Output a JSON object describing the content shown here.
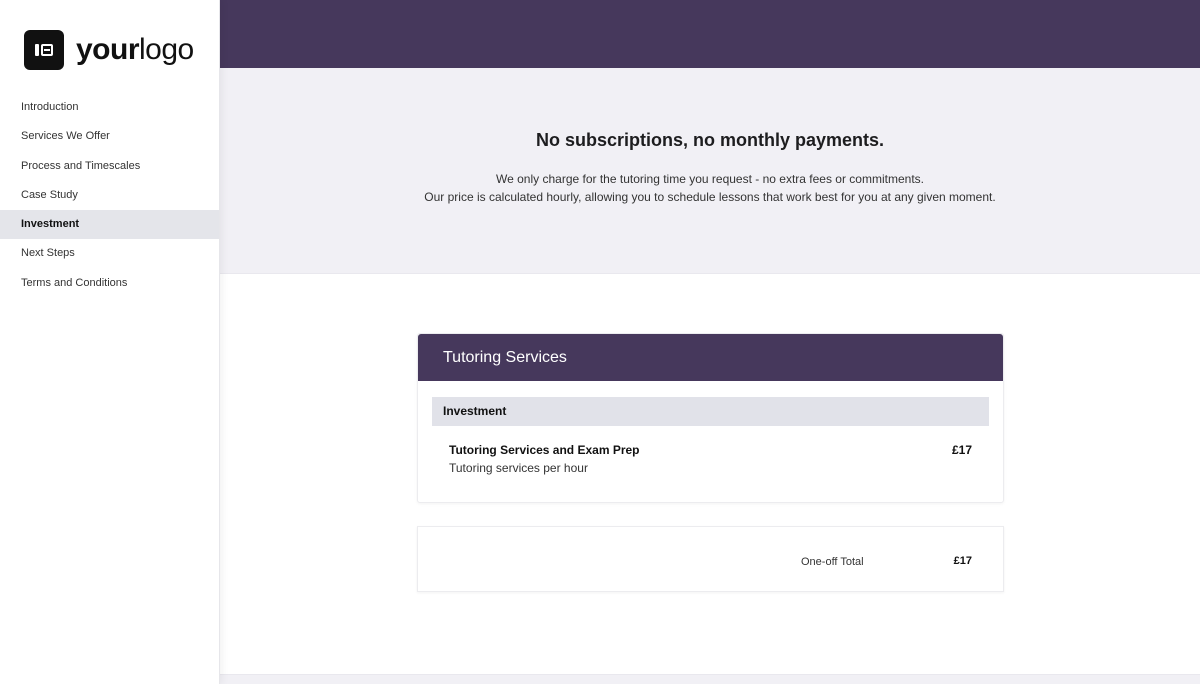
{
  "logo": {
    "bold": "your",
    "regular": "logo"
  },
  "sidebar": {
    "items": [
      {
        "label": "Introduction",
        "active": false
      },
      {
        "label": "Services We Offer",
        "active": false
      },
      {
        "label": "Process and Timescales",
        "active": false
      },
      {
        "label": "Case Study",
        "active": false
      },
      {
        "label": "Investment",
        "active": true
      },
      {
        "label": "Next Steps",
        "active": false
      },
      {
        "label": "Terms and Conditions",
        "active": false
      }
    ]
  },
  "hero": {
    "title": "No subscriptions, no monthly payments.",
    "line1": "We only charge for the tutoring time you request - no extra fees or commitments.",
    "line2": "Our price is calculated hourly, allowing you to schedule lessons that work best for you at any given moment."
  },
  "pricing": {
    "card_title": "Tutoring Services",
    "section_label": "Investment",
    "item": {
      "name": "Tutoring Services and Exam Prep",
      "description": "Tutoring services per hour",
      "price": "£17"
    },
    "total_label": "One-off Total",
    "total_value": "£17"
  },
  "colors": {
    "brand": "#46385c",
    "hero_bg": "#f1f0f5",
    "active_nav_bg": "#e4e5ea"
  }
}
